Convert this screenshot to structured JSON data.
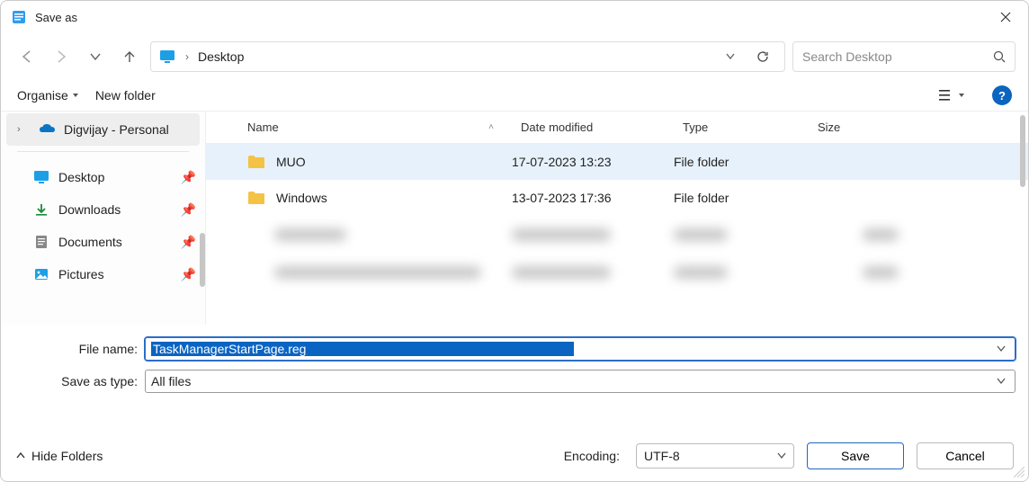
{
  "titlebar": {
    "title": "Save as"
  },
  "nav": {
    "location": "Desktop",
    "search_placeholder": "Search Desktop"
  },
  "toolbar": {
    "organise": "Organise",
    "newfolder": "New folder"
  },
  "sidebar": {
    "account": "Digvijay - Personal",
    "items": [
      {
        "label": "Desktop"
      },
      {
        "label": "Downloads"
      },
      {
        "label": "Documents"
      },
      {
        "label": "Pictures"
      }
    ]
  },
  "columns": {
    "name": "Name",
    "date": "Date modified",
    "type": "Type",
    "size": "Size"
  },
  "files": [
    {
      "name": "MUO",
      "date": "17-07-2023 13:23",
      "type": "File folder"
    },
    {
      "name": "Windows",
      "date": "13-07-2023 17:36",
      "type": "File folder"
    }
  ],
  "form": {
    "filename_label": "File name:",
    "filename_value": "TaskManagerStartPage.reg",
    "savetype_label": "Save as type:",
    "savetype_value": "All files"
  },
  "footer": {
    "hide_folders": "Hide Folders",
    "encoding_label": "Encoding:",
    "encoding_value": "UTF-8",
    "save": "Save",
    "cancel": "Cancel"
  }
}
